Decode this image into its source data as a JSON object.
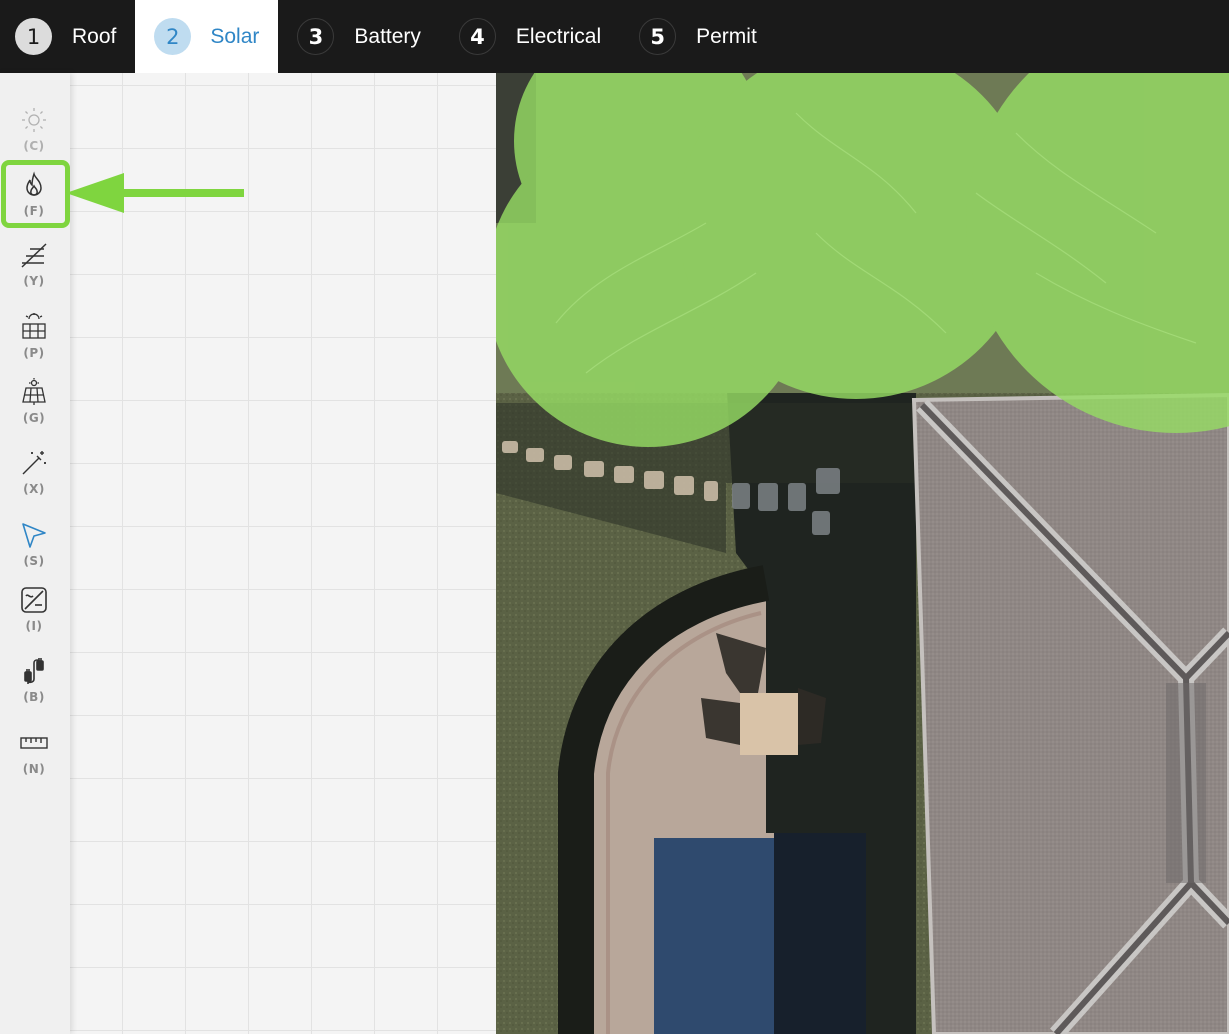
{
  "steps": [
    {
      "number": "1",
      "label": "Roof",
      "state": "done"
    },
    {
      "number": "2",
      "label": "Solar",
      "state": "active"
    },
    {
      "number": "3",
      "label": "Battery",
      "state": "inactive"
    },
    {
      "number": "4",
      "label": "Electrical",
      "state": "inactive"
    },
    {
      "number": "5",
      "label": "Permit",
      "state": "inactive"
    }
  ],
  "tools": [
    {
      "key": "(C)",
      "icon": "sun-icon"
    },
    {
      "key": "(F)",
      "icon": "fire-icon"
    },
    {
      "key": "(Y)",
      "icon": "stairs-lines-icon"
    },
    {
      "key": "(P)",
      "icon": "solar-panel-icon"
    },
    {
      "key": "(G)",
      "icon": "panel-grid-icon"
    },
    {
      "key": "(X)",
      "icon": "magic-wand-icon"
    },
    {
      "key": "(S)",
      "icon": "cursor-arrow-icon"
    },
    {
      "key": "(I)",
      "icon": "inverter-icon"
    },
    {
      "key": "(B)",
      "icon": "battery-cable-icon"
    },
    {
      "key": "(N)",
      "icon": "ruler-icon"
    }
  ],
  "colors": {
    "topbar": "#1a1a1a",
    "active_step": "#2f86c6",
    "highlight": "#7fd53f",
    "tree_overlay": "#96dc64"
  }
}
